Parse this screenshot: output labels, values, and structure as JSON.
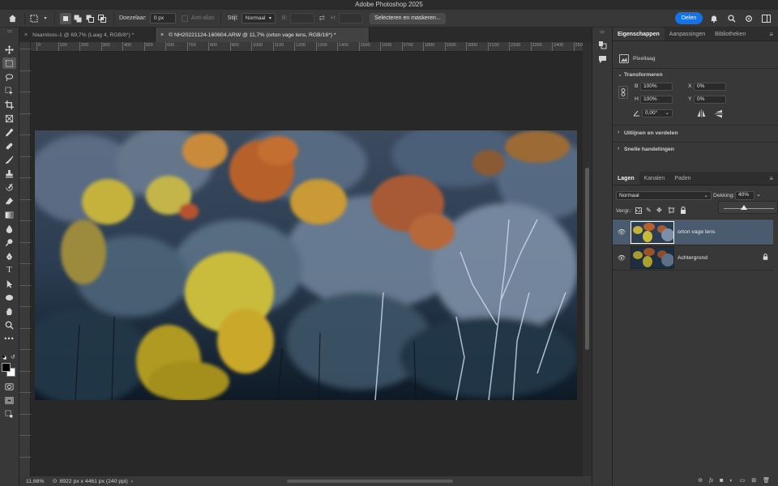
{
  "app": {
    "title": "Adobe Photoshop 2025"
  },
  "options_bar": {
    "feather_label": "Doezelaar:",
    "feather_value": "0 px",
    "antialias_label": "Anti-alias",
    "style_label": "Stijl:",
    "style_value": "Normaal",
    "width_label": "B:",
    "height_label": "H:",
    "select_mask_button": "Selecteren en maskeren...",
    "share_button": "Delen"
  },
  "tabs": [
    {
      "label": "Naamloos-1 @ 69,7% (Laag 4, RGB/8*) *",
      "active": false
    },
    {
      "label": "© NH20221124-160604.ARW @ 11,7% (orton vage lens, RGB/16*) *",
      "active": true
    }
  ],
  "ruler_labels": [
    "0",
    "100",
    "200",
    "300",
    "400",
    "500",
    "600",
    "700",
    "800",
    "900",
    "1000",
    "1100",
    "1200",
    "1300",
    "1400",
    "1500",
    "1600",
    "1700",
    "1800",
    "1900",
    "2000",
    "2100",
    "2200",
    "2300",
    "2400",
    "2500"
  ],
  "status": {
    "zoom": "11,68%",
    "doc_info": "8922 px x 4461 px (240 ppi)"
  },
  "properties": {
    "tabs": [
      "Eigenschappen",
      "Aanpassingen",
      "Bibliotheken"
    ],
    "layer_type": "Pixellaag",
    "transform_title": "Transformeren",
    "w_label": "B",
    "w_value": "100%",
    "h_label": "H",
    "h_value": "100%",
    "x_label": "X",
    "x_value": "0%",
    "y_label": "Y",
    "y_value": "0%",
    "angle_value": "0,00°",
    "align_section": "Uitlijnen en verdelen",
    "quick_actions": "Snelle handelingen"
  },
  "layers": {
    "tabs": [
      "Lagen",
      "Kanalen",
      "Paden"
    ],
    "blend_mode": "Normaal",
    "opacity_label": "Dekking:",
    "opacity_value": "40%",
    "opacity_fraction": 0.4,
    "lock_label": "Vergr.:",
    "items": [
      {
        "name": "orton vage lens",
        "selected": true,
        "locked": false
      },
      {
        "name": "Achtergrond",
        "selected": false,
        "locked": true
      }
    ]
  },
  "colors": {
    "accent": "#1473e6",
    "selected_layer": "#4b5b6f"
  }
}
